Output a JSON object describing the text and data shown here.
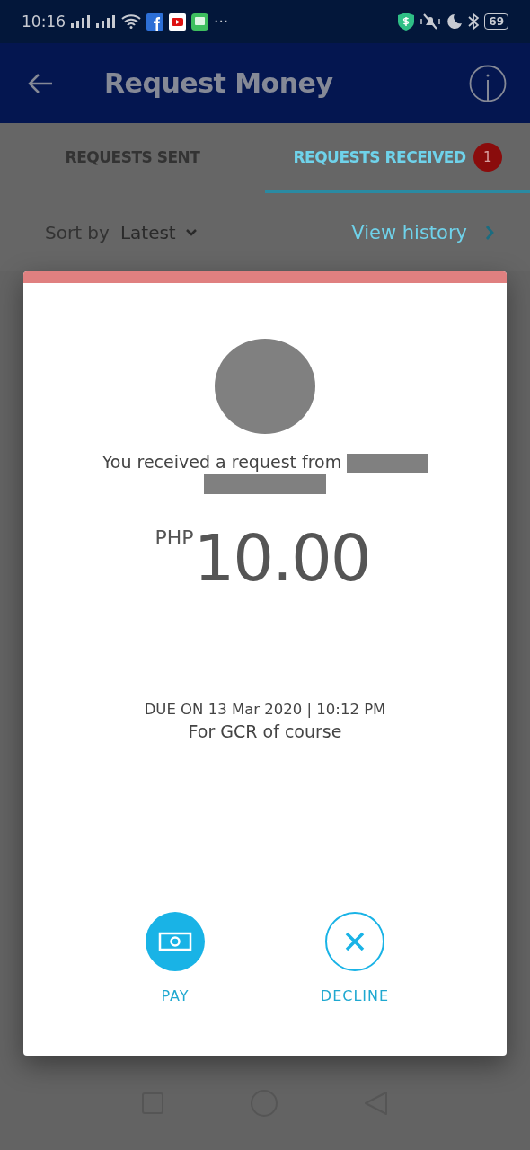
{
  "status_bar": {
    "time": "10:16",
    "more": "···",
    "battery": "69"
  },
  "header": {
    "title": "Request Money"
  },
  "tabs": [
    {
      "label": "REQUESTS SENT",
      "selected": false
    },
    {
      "label": "REQUESTS RECEIVED",
      "selected": true,
      "badge": "1"
    }
  ],
  "sort": {
    "label": "Sort by",
    "value": "Latest"
  },
  "view_history": "View history",
  "request": {
    "message": "You received a request from",
    "currency": "PHP",
    "amount": "10.00",
    "due": "DUE ON 13 Mar 2020 | 10:12 PM",
    "note": "For GCR of course",
    "actions": [
      {
        "label": "PAY",
        "kind": "pay"
      },
      {
        "label": "DECLINE",
        "kind": "decline"
      }
    ]
  }
}
